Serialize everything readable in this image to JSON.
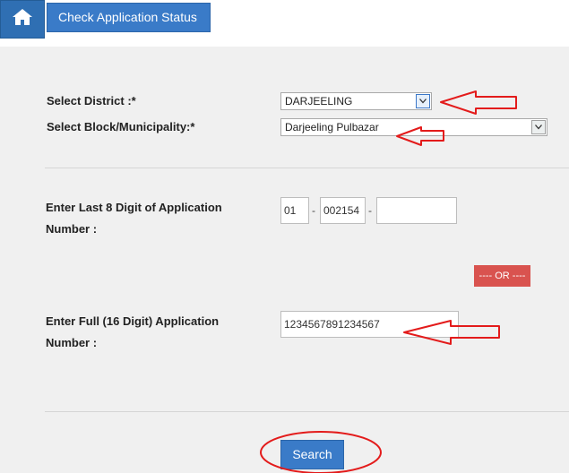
{
  "header": {
    "home_icon": "home-icon",
    "title": "Check Application Status",
    "accent_color": "#3a7bc8"
  },
  "form": {
    "district": {
      "label": "Select District :*",
      "value": "DARJEELING"
    },
    "block": {
      "label": "Select Block/Municipality:*",
      "value": "Darjeeling Pulbazar"
    },
    "last8": {
      "label_line1": "Enter Last 8 Digit of Application",
      "label_line2": "Number :",
      "part1": "01",
      "sep1": "-",
      "part2": "002154",
      "sep2": "-",
      "part3": ""
    },
    "or_label": "---- OR ----",
    "full16": {
      "label_line1": "Enter Full (16 Digit) Application",
      "label_line2": "Number :",
      "value": "1234567891234567"
    },
    "search_label": "Search"
  },
  "annotations": {
    "color": "#e31b1b"
  }
}
